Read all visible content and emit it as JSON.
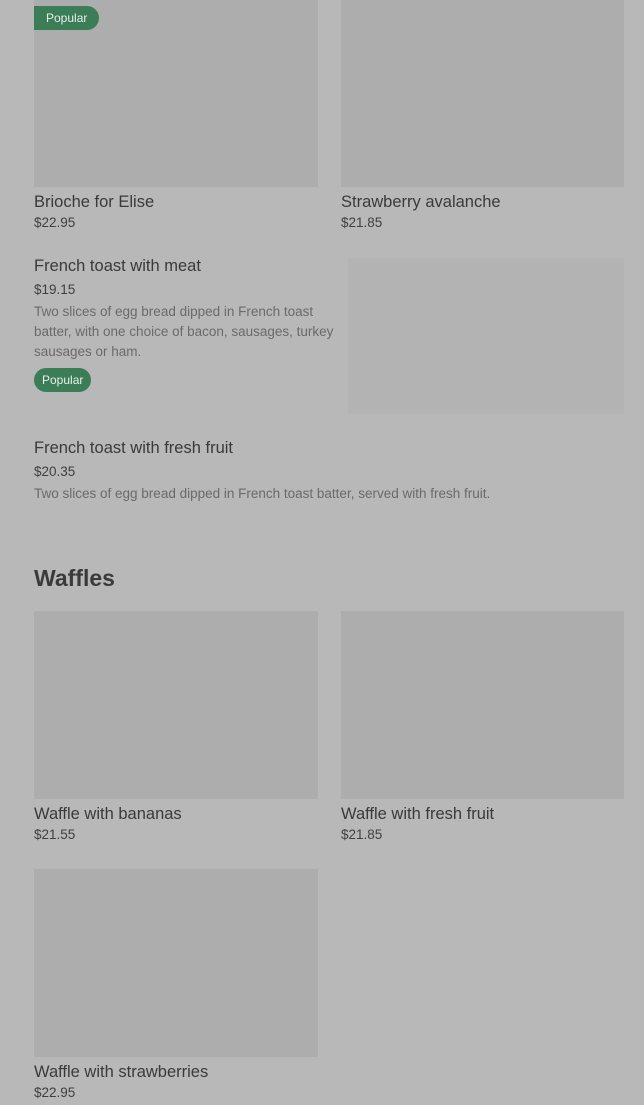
{
  "top_cards": [
    {
      "name": "Brioche for Elise",
      "price": "$22.95",
      "badge": "Popular"
    },
    {
      "name": "Strawberry avalanche",
      "price": "$21.85"
    }
  ],
  "list_items": [
    {
      "name": "French toast with meat",
      "price": "$19.15",
      "description": "Two slices of egg bread dipped in French toast batter, with one choice of bacon, sausages, turkey sausages or ham.",
      "badge": "Popular"
    },
    {
      "name": "French toast with fresh fruit",
      "price": "$20.35",
      "description": "Two slices of egg bread dipped in French toast batter, served with fresh fruit."
    }
  ],
  "waffles_section": {
    "title": "Waffles",
    "items": [
      {
        "name": "Waffle with bananas",
        "price": "$21.55"
      },
      {
        "name": "Waffle with fresh fruit",
        "price": "$21.85"
      },
      {
        "name": "Waffle with strawberries",
        "price": "$22.95"
      }
    ]
  },
  "colors": {
    "overlay_background": "#b8b8b8",
    "image_placeholder": "#adadad",
    "badge_green": "#3b7d57"
  }
}
